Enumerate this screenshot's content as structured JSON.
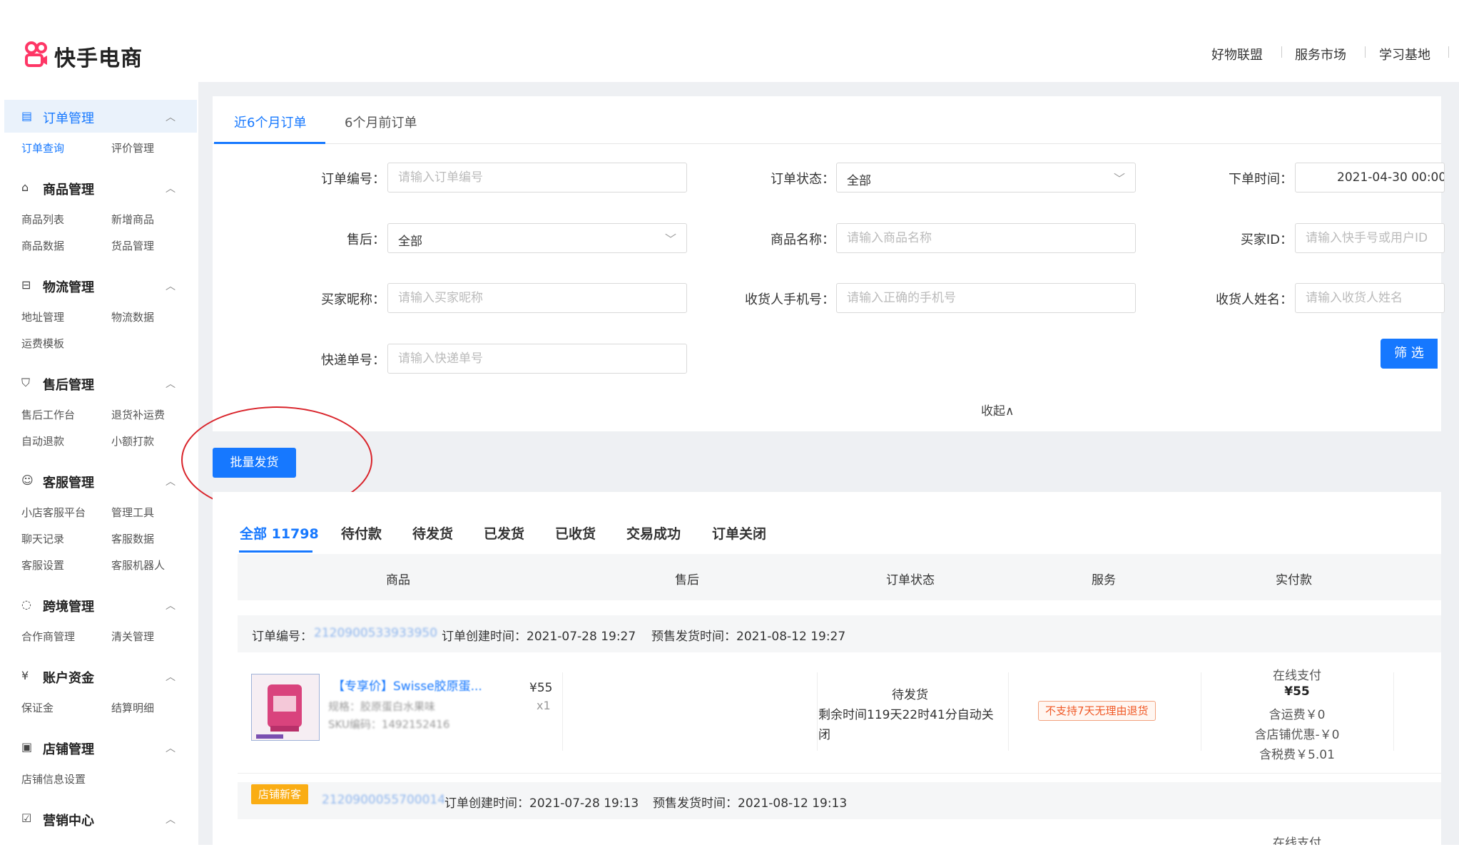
{
  "header": {
    "logo_text": "快手电商",
    "links": [
      "好物联盟",
      "服务市场",
      "学习基地"
    ]
  },
  "sidebar": {
    "groups": [
      {
        "title": "订单管理",
        "icon": "order-icon",
        "items": [
          "订单查询",
          "评价管理"
        ]
      },
      {
        "title": "商品管理",
        "icon": "goods-icon",
        "items": [
          "商品列表",
          "新增商品",
          "商品数据",
          "货品管理"
        ]
      },
      {
        "title": "物流管理",
        "icon": "logistics-icon",
        "items": [
          "地址管理",
          "物流数据",
          "运费模板"
        ]
      },
      {
        "title": "售后管理",
        "icon": "aftersale-icon",
        "items": [
          "售后工作台",
          "退货补运费",
          "自动退款",
          "小额打款"
        ]
      },
      {
        "title": "客服管理",
        "icon": "customer-service-icon",
        "items": [
          "小店客服平台",
          "管理工具",
          "聊天记录",
          "客服数据",
          "客服设置",
          "客服机器人"
        ]
      },
      {
        "title": "跨境管理",
        "icon": "cross-border-icon",
        "items": [
          "合作商管理",
          "清关管理"
        ]
      },
      {
        "title": "账户资金",
        "icon": "funds-icon",
        "items": [
          "保证金",
          "结算明细"
        ]
      },
      {
        "title": "店铺管理",
        "icon": "shop-icon",
        "items": [
          "店铺信息设置"
        ]
      },
      {
        "title": "营销中心",
        "icon": "marketing-icon",
        "items": []
      }
    ]
  },
  "tabs": {
    "recent": "近6个月订单",
    "older": "6个月前订单"
  },
  "filters": {
    "order_no": {
      "label": "订单编号：",
      "placeholder": "请输入订单编号"
    },
    "order_status": {
      "label": "订单状态：",
      "value": "全部"
    },
    "order_time": {
      "label": "下单时间：",
      "value": "2021-04-30 00:00"
    },
    "after_sale": {
      "label": "售后：",
      "value": "全部"
    },
    "product_name": {
      "label": "商品名称：",
      "placeholder": "请输入商品名称"
    },
    "buyer_id": {
      "label": "买家ID：",
      "placeholder": "请输入快手号或用户ID"
    },
    "buyer_nick": {
      "label": "买家昵称：",
      "placeholder": "请输入买家昵称"
    },
    "receiver_phone": {
      "label": "收货人手机号：",
      "placeholder": "请输入正确的手机号"
    },
    "receiver_name": {
      "label": "收货人姓名：",
      "placeholder": "请输入收货人姓名"
    },
    "express_no": {
      "label": "快递单号：",
      "placeholder": "请输入快递单号"
    },
    "filter_button": "筛 选",
    "collapse": "收起∧"
  },
  "batch_ship": "批量发货",
  "status_tabs": [
    "全部 11798",
    "待付款",
    "待发货",
    "已发货",
    "已收货",
    "交易成功",
    "订单关闭"
  ],
  "table_headers": [
    "商品",
    "售后",
    "订单状态",
    "服务",
    "实付款"
  ],
  "orders": [
    {
      "header_prefix": "订单编号：",
      "order_no_blur": "2120900533933950",
      "created": "订单创建时间：2021-07-28 19:27",
      "presale": "预售发货时间：2021-08-12 19:27",
      "title": "【专享价】Swisse胶原蛋...",
      "meta1": "规格：胶原蛋白水果味",
      "meta2": "SKU编码：1492152416",
      "price": "¥55",
      "qty": "x1",
      "status": "待发货",
      "status_detail1": "剩余时间119天22时41分自动关",
      "status_detail2": "闭",
      "service_tag": "不支持7天无理由退货",
      "pay_method": "在线支付",
      "paid": "¥55",
      "shipping": "含运费￥0",
      "shop_discount": "含店铺优惠-￥0",
      "tax": "含税费￥5.01"
    },
    {
      "badge": "店铺新客",
      "order_no_blur": "2120900055700014",
      "created": "订单创建时间：2021-07-28 19:13",
      "presale": "预售发货时间：2021-08-12 19:13",
      "pay_method": "在线支付"
    }
  ],
  "colors": {
    "primary": "#1678ff",
    "logo": "#fe3666",
    "badge": "#faad14",
    "warning": "#f05a28"
  }
}
